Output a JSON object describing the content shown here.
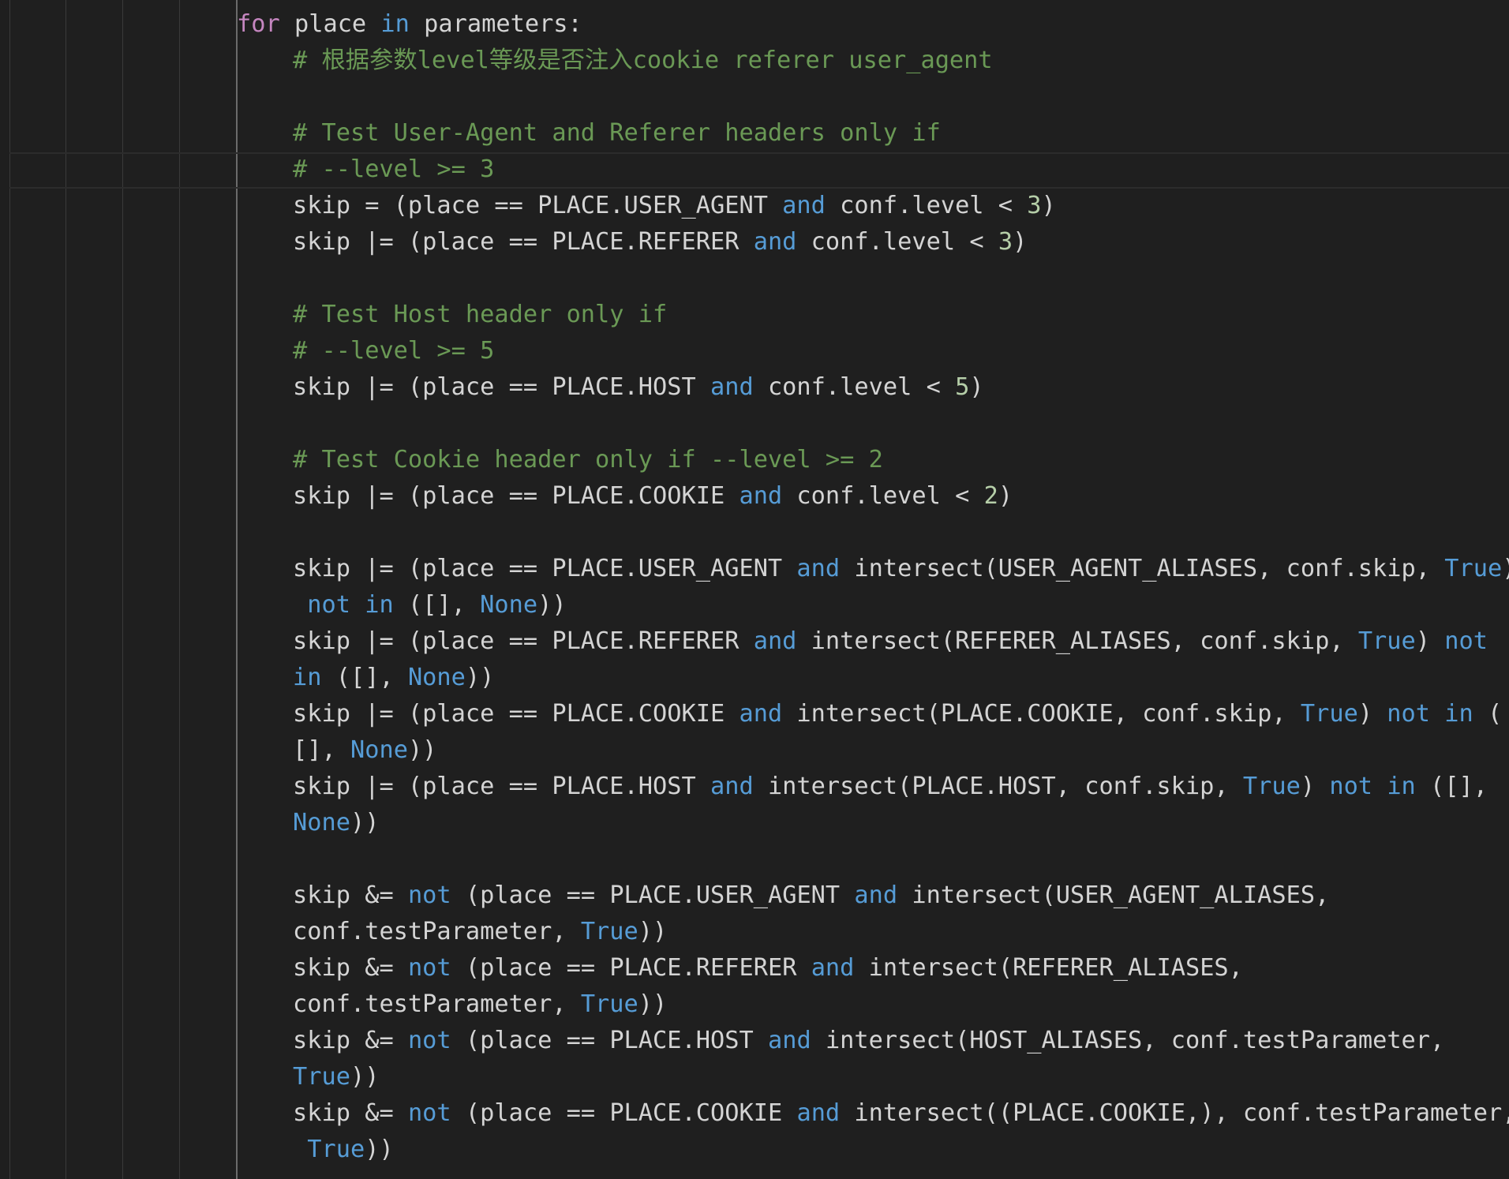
{
  "editor": {
    "colors": {
      "background": "#1f1f1f",
      "text": "#d4d4d4",
      "keyword_control": "#c586c0",
      "keyword_operator": "#569cd6",
      "comment": "#6a9955",
      "number": "#b5cea8"
    },
    "lines": [
      {
        "indent": 1,
        "tokens": [
          {
            "t": "for",
            "k": "kw"
          },
          {
            "t": " place ",
            "k": "tx"
          },
          {
            "t": "in",
            "k": "op"
          },
          {
            "t": " parameters:",
            "k": "tx"
          }
        ]
      },
      {
        "indent": 2,
        "tokens": [
          {
            "t": "# 根据参数level等级是否注入cookie referer user_agent",
            "k": "cm"
          }
        ]
      },
      {
        "indent": 2,
        "tokens": []
      },
      {
        "indent": 2,
        "tokens": [
          {
            "t": "# Test User-Agent and Referer headers only if",
            "k": "cm"
          }
        ]
      },
      {
        "indent": 2,
        "tokens": [
          {
            "t": "# --level >= 3",
            "k": "cm"
          }
        ]
      },
      {
        "indent": 2,
        "tokens": [
          {
            "t": "skip = (place == PLACE.USER_AGENT ",
            "k": "tx"
          },
          {
            "t": "and",
            "k": "op"
          },
          {
            "t": " conf.level < ",
            "k": "tx"
          },
          {
            "t": "3",
            "k": "num"
          },
          {
            "t": ")",
            "k": "tx"
          }
        ]
      },
      {
        "indent": 2,
        "tokens": [
          {
            "t": "skip |= (place == PLACE.REFERER ",
            "k": "tx"
          },
          {
            "t": "and",
            "k": "op"
          },
          {
            "t": " conf.level < ",
            "k": "tx"
          },
          {
            "t": "3",
            "k": "num"
          },
          {
            "t": ")",
            "k": "tx"
          }
        ]
      },
      {
        "indent": 2,
        "tokens": []
      },
      {
        "indent": 2,
        "tokens": [
          {
            "t": "# Test Host header only if",
            "k": "cm"
          }
        ]
      },
      {
        "indent": 2,
        "tokens": [
          {
            "t": "# --level >= 5",
            "k": "cm"
          }
        ]
      },
      {
        "indent": 2,
        "tokens": [
          {
            "t": "skip |= (place == PLACE.HOST ",
            "k": "tx"
          },
          {
            "t": "and",
            "k": "op"
          },
          {
            "t": " conf.level < ",
            "k": "tx"
          },
          {
            "t": "5",
            "k": "num"
          },
          {
            "t": ")",
            "k": "tx"
          }
        ]
      },
      {
        "indent": 2,
        "tokens": []
      },
      {
        "indent": 2,
        "tokens": [
          {
            "t": "# Test Cookie header only if --level >= 2",
            "k": "cm"
          }
        ]
      },
      {
        "indent": 2,
        "tokens": [
          {
            "t": "skip |= (place == PLACE.COOKIE ",
            "k": "tx"
          },
          {
            "t": "and",
            "k": "op"
          },
          {
            "t": " conf.level < ",
            "k": "tx"
          },
          {
            "t": "2",
            "k": "num"
          },
          {
            "t": ")",
            "k": "tx"
          }
        ]
      },
      {
        "indent": 2,
        "tokens": []
      },
      {
        "indent": 2,
        "tokens": [
          {
            "t": "skip |= (place == PLACE.USER_AGENT ",
            "k": "tx"
          },
          {
            "t": "and",
            "k": "op"
          },
          {
            "t": " intersect(USER_AGENT_ALIASES, conf.skip, ",
            "k": "tx"
          },
          {
            "t": "True",
            "k": "op"
          },
          {
            "t": ")",
            "k": "tx"
          }
        ]
      },
      {
        "indent": 2,
        "tokens": [
          {
            "t": " ",
            "k": "tx"
          },
          {
            "t": "not",
            "k": "op"
          },
          {
            "t": " ",
            "k": "tx"
          },
          {
            "t": "in",
            "k": "op"
          },
          {
            "t": " ([], ",
            "k": "tx"
          },
          {
            "t": "None",
            "k": "op"
          },
          {
            "t": "))",
            "k": "tx"
          }
        ]
      },
      {
        "indent": 2,
        "tokens": [
          {
            "t": "skip |= (place == PLACE.REFERER ",
            "k": "tx"
          },
          {
            "t": "and",
            "k": "op"
          },
          {
            "t": " intersect(REFERER_ALIASES, conf.skip, ",
            "k": "tx"
          },
          {
            "t": "True",
            "k": "op"
          },
          {
            "t": ") ",
            "k": "tx"
          },
          {
            "t": "not",
            "k": "op"
          }
        ]
      },
      {
        "indent": 2,
        "tokens": [
          {
            "t": "in",
            "k": "op"
          },
          {
            "t": " ([], ",
            "k": "tx"
          },
          {
            "t": "None",
            "k": "op"
          },
          {
            "t": "))",
            "k": "tx"
          }
        ]
      },
      {
        "indent": 2,
        "tokens": [
          {
            "t": "skip |= (place == PLACE.COOKIE ",
            "k": "tx"
          },
          {
            "t": "and",
            "k": "op"
          },
          {
            "t": " intersect(PLACE.COOKIE, conf.skip, ",
            "k": "tx"
          },
          {
            "t": "True",
            "k": "op"
          },
          {
            "t": ") ",
            "k": "tx"
          },
          {
            "t": "not",
            "k": "op"
          },
          {
            "t": " ",
            "k": "tx"
          },
          {
            "t": "in",
            "k": "op"
          },
          {
            "t": " (",
            "k": "tx"
          }
        ]
      },
      {
        "indent": 2,
        "tokens": [
          {
            "t": "[], ",
            "k": "tx"
          },
          {
            "t": "None",
            "k": "op"
          },
          {
            "t": "))",
            "k": "tx"
          }
        ]
      },
      {
        "indent": 2,
        "tokens": [
          {
            "t": "skip |= (place == PLACE.HOST ",
            "k": "tx"
          },
          {
            "t": "and",
            "k": "op"
          },
          {
            "t": " intersect(PLACE.HOST, conf.skip, ",
            "k": "tx"
          },
          {
            "t": "True",
            "k": "op"
          },
          {
            "t": ") ",
            "k": "tx"
          },
          {
            "t": "not",
            "k": "op"
          },
          {
            "t": " ",
            "k": "tx"
          },
          {
            "t": "in",
            "k": "op"
          },
          {
            "t": " ([],",
            "k": "tx"
          }
        ]
      },
      {
        "indent": 2,
        "tokens": [
          {
            "t": "None",
            "k": "op"
          },
          {
            "t": "))",
            "k": "tx"
          }
        ]
      },
      {
        "indent": 2,
        "tokens": []
      },
      {
        "indent": 2,
        "tokens": [
          {
            "t": "skip &= ",
            "k": "tx"
          },
          {
            "t": "not",
            "k": "op"
          },
          {
            "t": " (place == PLACE.USER_AGENT ",
            "k": "tx"
          },
          {
            "t": "and",
            "k": "op"
          },
          {
            "t": " intersect(USER_AGENT_ALIASES,",
            "k": "tx"
          }
        ]
      },
      {
        "indent": 2,
        "tokens": [
          {
            "t": "conf.testParameter, ",
            "k": "tx"
          },
          {
            "t": "True",
            "k": "op"
          },
          {
            "t": "))",
            "k": "tx"
          }
        ]
      },
      {
        "indent": 2,
        "tokens": [
          {
            "t": "skip &= ",
            "k": "tx"
          },
          {
            "t": "not",
            "k": "op"
          },
          {
            "t": " (place == PLACE.REFERER ",
            "k": "tx"
          },
          {
            "t": "and",
            "k": "op"
          },
          {
            "t": " intersect(REFERER_ALIASES,",
            "k": "tx"
          }
        ]
      },
      {
        "indent": 2,
        "tokens": [
          {
            "t": "conf.testParameter, ",
            "k": "tx"
          },
          {
            "t": "True",
            "k": "op"
          },
          {
            "t": "))",
            "k": "tx"
          }
        ]
      },
      {
        "indent": 2,
        "tokens": [
          {
            "t": "skip &= ",
            "k": "tx"
          },
          {
            "t": "not",
            "k": "op"
          },
          {
            "t": " (place == PLACE.HOST ",
            "k": "tx"
          },
          {
            "t": "and",
            "k": "op"
          },
          {
            "t": " intersect(HOST_ALIASES, conf.testParameter,",
            "k": "tx"
          }
        ]
      },
      {
        "indent": 2,
        "tokens": [
          {
            "t": "True",
            "k": "op"
          },
          {
            "t": "))",
            "k": "tx"
          }
        ]
      },
      {
        "indent": 2,
        "tokens": [
          {
            "t": "skip &= ",
            "k": "tx"
          },
          {
            "t": "not",
            "k": "op"
          },
          {
            "t": " (place == PLACE.COOKIE ",
            "k": "tx"
          },
          {
            "t": "and",
            "k": "op"
          },
          {
            "t": " intersect((PLACE.COOKIE,), conf.testParameter,",
            "k": "tx"
          }
        ]
      },
      {
        "indent": 2,
        "tokens": [
          {
            "t": " ",
            "k": "tx"
          },
          {
            "t": "True",
            "k": "op"
          },
          {
            "t": "))",
            "k": "tx"
          }
        ]
      }
    ]
  }
}
